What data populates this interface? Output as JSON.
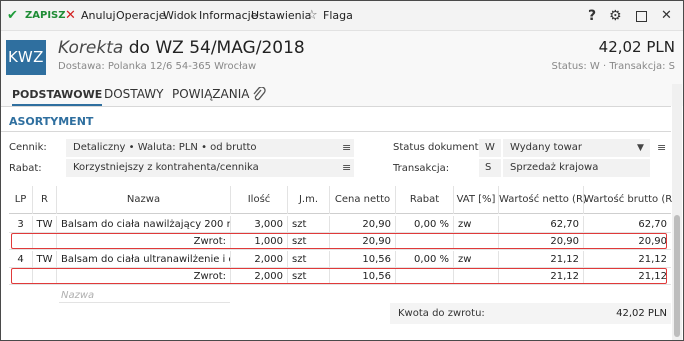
{
  "toolbar": {
    "save": "ZAPISZ",
    "cancel": "Anuluj",
    "operations": "Operacje",
    "view": "Widok",
    "info": "Informacje",
    "settings": "Ustawienia",
    "flag": "Flaga",
    "icons": [
      "check-icon",
      "x-icon",
      "star-icon",
      "help-icon",
      "gear-icon",
      "maximize-icon",
      "close-icon"
    ]
  },
  "header": {
    "badge": "KWZ",
    "kind": "Korekta",
    "title": "do WZ 54/MAG/2018",
    "delivery": "Dostawa: Polanka  12/6  54-365 Wrocław",
    "amount": "42,02 PLN",
    "status": "Status: W  ·  Transakcja: S"
  },
  "tabs": [
    "PODSTAWOWE",
    "DOSTAWY",
    "POWIĄZANIA"
  ],
  "section": {
    "title": "ASORTYMENT"
  },
  "form": {
    "price_list_label": "Cennik:",
    "price_list_value": "Detaliczny • Waluta: PLN • od brutto",
    "discount_label": "Rabat:",
    "discount_value": "Korzystniejszy z kontrahenta/cennika",
    "doc_status_label": "Status dokumentu:",
    "doc_status_code": "W",
    "doc_status_value": "Wydany towar",
    "transaction_label": "Transakcja:",
    "transaction_code": "S",
    "transaction_value": "Sprzedaż krajowa"
  },
  "grid": {
    "headers": [
      "LP",
      "R",
      "Nazwa",
      "Ilość",
      "J.m.",
      "Cena netto",
      "Rabat",
      "VAT [%]",
      "Wartość netto (R)",
      "Wartość brutto (R)"
    ],
    "rows": [
      {
        "lp": "3",
        "r": "TW",
        "name": "Balsam do ciała nawilżający 200 ml",
        "qty": "3,000",
        "unit": "szt",
        "price": "20,90",
        "discount": "0,00 %",
        "vat": "zw",
        "net": "62,70",
        "gross": "62,70"
      },
      {
        "lp": "",
        "r": "",
        "name": "Zwrot:",
        "qty": "1,000",
        "unit": "szt",
        "price": "20,90",
        "discount": "",
        "vat": "",
        "net": "20,90",
        "gross": "20,90"
      },
      {
        "lp": "4",
        "r": "TW",
        "name": "Balsam do ciała ultranawilżenie i dotlen…",
        "qty": "2,000",
        "unit": "szt",
        "price": "10,56",
        "discount": "0,00 %",
        "vat": "zw",
        "net": "21,12",
        "gross": "21,12"
      },
      {
        "lp": "",
        "r": "",
        "name": "Zwrot:",
        "qty": "2,000",
        "unit": "szt",
        "price": "10,56",
        "discount": "",
        "vat": "",
        "net": "21,12",
        "gross": "21,12"
      }
    ],
    "new_row_placeholder": "Nazwa"
  },
  "footer": {
    "refund_label": "Kwota do zwrotu:",
    "refund_value": "42,02 PLN"
  },
  "colors": {
    "accent": "#2f6f9f",
    "save_green": "#1e9c3a",
    "cancel_red": "#d21f1f",
    "highlight_red": "#e03a3a"
  }
}
